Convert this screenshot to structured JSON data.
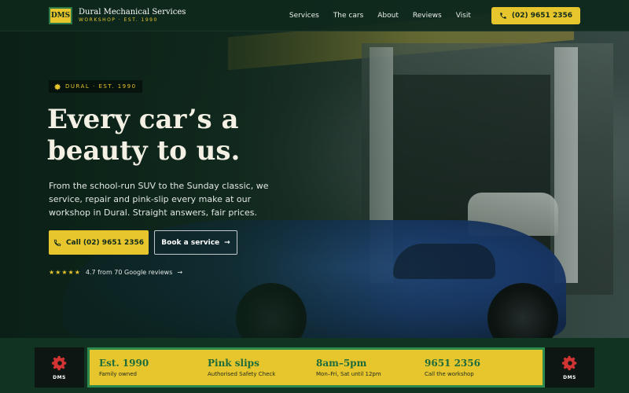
{
  "colors": {
    "brand_green": "#0f2a1c",
    "accent_yellow": "#e7c52c",
    "strip_green": "#2f8a4d"
  },
  "nav": {
    "logo_text": "DMS",
    "brand_name": "Dural Mechanical Services",
    "brand_sub": "WORKSHOP · EST. 1990",
    "links": [
      "Services",
      "The cars",
      "About",
      "Reviews",
      "Visit"
    ],
    "phone_label": "(02) 9651 2356",
    "phone_icon": "phone-icon"
  },
  "hero": {
    "tag_icon": "gear-icon",
    "tag": "DURAL · EST. 1990",
    "headline_line1": "Every car’s a",
    "headline_line2": "beauty to us.",
    "lede": "From the school-run SUV to the Sunday classic, we service, repair and pink-slip every make at our workshop in Dural. Straight answers, fair prices.",
    "call_button": "Call (02) 9651 2356",
    "book_button": "Book a service",
    "rating_stars": 5,
    "reviews_text": "4.7 from 70 Google reviews"
  },
  "strip": {
    "badge_text": "DMS",
    "badge_icon": "gear-icon",
    "items": [
      {
        "title": "Est. 1990",
        "sub": "Family owned"
      },
      {
        "title": "Pink slips",
        "sub": "Authorised Safety Check"
      },
      {
        "title": "8am–5pm",
        "sub": "Mon–Fri, Sat until 12pm"
      },
      {
        "title": "9651 2356",
        "sub": "Call the workshop"
      }
    ]
  }
}
